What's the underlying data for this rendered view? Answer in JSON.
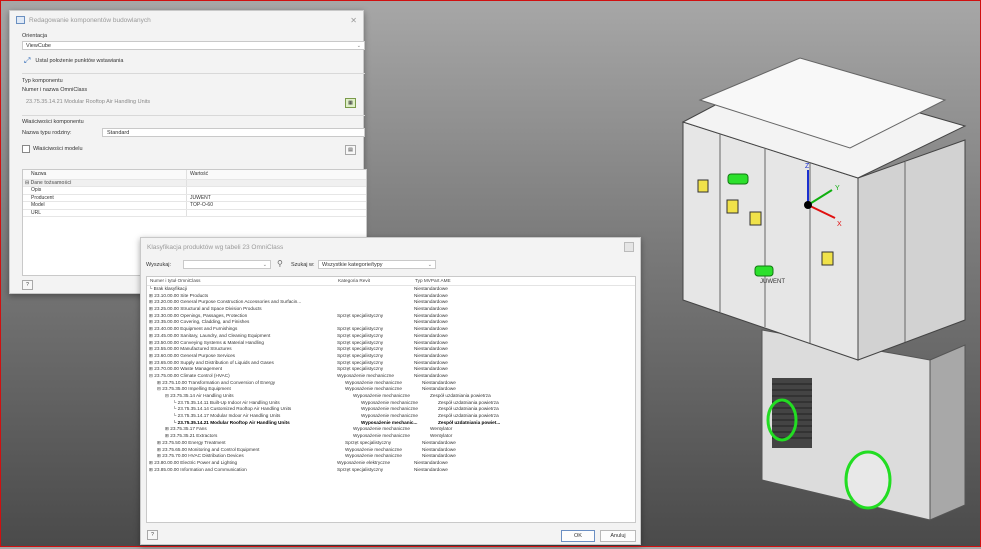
{
  "dialog1": {
    "title": "Redagowanie komponentów budowlanych",
    "orientation_label": "Orientacja",
    "orientation_value": "ViewCube",
    "insert_point_label": "Ustal położenie punktów wstawiania",
    "component_type_label": "Typ komponentu",
    "omniclass_label": "Numer i nazwa OmniClass",
    "omniclass_value": "23.75.35.14.21 Modular Rooftop Air Handling Units",
    "component_props_label": "Właściwości komponentu",
    "family_type_label": "Nazwa typu rodziny:",
    "family_type_value": "Standard",
    "model_props_label": "Właściwości modelu",
    "table": {
      "headers": [
        "Nazwa",
        "Wartość"
      ],
      "group": "Dane tożsamości",
      "rows": [
        {
          "name": "Opis",
          "value": ""
        },
        {
          "name": "Producent",
          "value": "JUWENT"
        },
        {
          "name": "Model",
          "value": "TOP-O-60"
        },
        {
          "name": "URL",
          "value": ""
        }
      ]
    }
  },
  "dialog2": {
    "title": "Klasyfikacja produktów wg tabeli 23 OmniClass",
    "search_label": "Wyszukaj:",
    "search_in_label": "Szukaj w:",
    "search_in_value": "Wszystkie kategorie/typy",
    "headers": [
      "Numer i tytuł OmniClass",
      "Kategoria Revit",
      "Typ MVPart AME"
    ],
    "rows": [
      {
        "indent": 0,
        "toggle": "",
        "name": "Brak klasyfikacji",
        "cat": "",
        "typ": "Niestandardowe"
      },
      {
        "indent": 0,
        "toggle": "+",
        "name": "23.10.00.00 Site Products",
        "cat": "",
        "typ": "Niestandardowe"
      },
      {
        "indent": 0,
        "toggle": "+",
        "name": "23.20.00.00 General Purpose Construction Accessories and Surfacin...",
        "cat": "",
        "typ": "Niestandardowe"
      },
      {
        "indent": 0,
        "toggle": "+",
        "name": "23.25.00.00 Structural and Space Division Products",
        "cat": "",
        "typ": "Niestandardowe"
      },
      {
        "indent": 0,
        "toggle": "+",
        "name": "23.30.00.00 Openings, Passages, Protection",
        "cat": "Sprzęt specjalistyczny",
        "typ": "Niestandardowe"
      },
      {
        "indent": 0,
        "toggle": "+",
        "name": "23.35.00.00 Covering, Cladding, and Finishes",
        "cat": "",
        "typ": "Niestandardowe"
      },
      {
        "indent": 0,
        "toggle": "+",
        "name": "23.40.00.00 Equipment and Furnishings",
        "cat": "Sprzęt specjalistyczny",
        "typ": "Niestandardowe"
      },
      {
        "indent": 0,
        "toggle": "+",
        "name": "23.45.00.00 Sanitary, Laundry, and Cleaning Equipment",
        "cat": "Sprzęt specjalistyczny",
        "typ": "Niestandardowe"
      },
      {
        "indent": 0,
        "toggle": "+",
        "name": "23.50.00.00 Conveying Systems & Material Handling",
        "cat": "Sprzęt specjalistyczny",
        "typ": "Niestandardowe"
      },
      {
        "indent": 0,
        "toggle": "+",
        "name": "23.55.00.00 Manufactured Structures",
        "cat": "Sprzęt specjalistyczny",
        "typ": "Niestandardowe"
      },
      {
        "indent": 0,
        "toggle": "+",
        "name": "23.60.00.00 General Purpose Services",
        "cat": "Sprzęt specjalistyczny",
        "typ": "Niestandardowe"
      },
      {
        "indent": 0,
        "toggle": "+",
        "name": "23.65.00.00 Supply and Distribution of Liquids and Gases",
        "cat": "Sprzęt specjalistyczny",
        "typ": "Niestandardowe"
      },
      {
        "indent": 0,
        "toggle": "+",
        "name": "23.70.00.00 Waste Management",
        "cat": "Sprzęt specjalistyczny",
        "typ": "Niestandardowe"
      },
      {
        "indent": 0,
        "toggle": "-",
        "name": "23.75.00.00 Climate Control (HVAC)",
        "cat": "Wyposażenie mechaniczne",
        "typ": "Niestandardowe"
      },
      {
        "indent": 1,
        "toggle": "+",
        "name": "23.75.10.00 Transformation and Conversion of Energy",
        "cat": "Wyposażenie mechaniczne",
        "typ": "Niestandardowe"
      },
      {
        "indent": 1,
        "toggle": "-",
        "name": "23.75.35.00 Impelling Equipment",
        "cat": "Wyposażenie mechaniczne",
        "typ": "Niestandardowe"
      },
      {
        "indent": 2,
        "toggle": "-",
        "name": "23.75.35.14 Air Handling Units",
        "cat": "Wyposażenie mechaniczne",
        "typ": "Zespół uzdatniania powietrza"
      },
      {
        "indent": 3,
        "toggle": "",
        "name": "23.75.35.14.11 Built-Up Indoor Air Handling Units",
        "cat": "Wyposażenie mechaniczne",
        "typ": "Zespół uzdatniania powietrza"
      },
      {
        "indent": 3,
        "toggle": "",
        "name": "23.75.35.14.14 Customized Rooftop Air Handling Units",
        "cat": "Wyposażenie mechaniczne",
        "typ": "Zespół uzdatniania powietrza"
      },
      {
        "indent": 3,
        "toggle": "",
        "name": "23.75.35.14.17 Modular Indoor Air Handling Units",
        "cat": "Wyposażenie mechaniczne",
        "typ": "Zespół uzdatniania powietrza"
      },
      {
        "indent": 3,
        "toggle": "",
        "name": "23.75.35.14.21 Modular Rooftop Air Handling Units",
        "cat": "Wyposażenie mechanic...",
        "typ": "Zespół uzdatniania powiet...",
        "bold": true
      },
      {
        "indent": 2,
        "toggle": "+",
        "name": "23.75.35.17 Fans",
        "cat": "Wyposażenie mechaniczne",
        "typ": "Wentylator"
      },
      {
        "indent": 2,
        "toggle": "+",
        "name": "23.75.35.21 Extractors",
        "cat": "Wyposażenie mechaniczne",
        "typ": "Wentylator"
      },
      {
        "indent": 1,
        "toggle": "+",
        "name": "23.75.50.00 Energy Treatment",
        "cat": "Sprzęt specjalistyczny",
        "typ": "Niestandardowe"
      },
      {
        "indent": 1,
        "toggle": "+",
        "name": "23.75.65.00 Monitoring and Control Equipment",
        "cat": "Wyposażenie mechaniczne",
        "typ": "Niestandardowe"
      },
      {
        "indent": 1,
        "toggle": "+",
        "name": "23.75.70.00 HVAC Distribution Devices",
        "cat": "Wyposażenie mechaniczne",
        "typ": "Niestandardowe"
      },
      {
        "indent": 0,
        "toggle": "+",
        "name": "23.80.00.00 Electric Power and Lighting",
        "cat": "Wyposażenie elektryczne",
        "typ": "Niestandardowe"
      },
      {
        "indent": 0,
        "toggle": "+",
        "name": "23.85.00.00 Information and Communication",
        "cat": "Sprzęt specjalistyczny",
        "typ": "Niestandardowe"
      }
    ],
    "ok_label": "OK",
    "cancel_label": "Anuluj"
  },
  "viewport": {
    "brand": "JUWENT",
    "axis_x": "X",
    "axis_y": "Y",
    "axis_z": "Z",
    "colors": {
      "gizmo": "#22dd22",
      "x_axis": "#e01010",
      "y_axis": "#10b010",
      "z_axis": "#1a2fd0"
    }
  }
}
